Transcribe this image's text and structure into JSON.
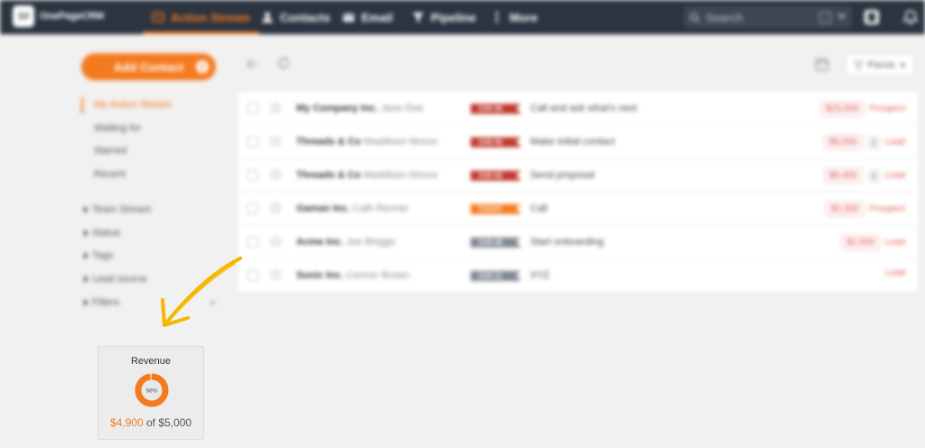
{
  "nav": {
    "logo_text": "OnePageCRM",
    "logo_mark": "1#",
    "items": [
      {
        "label": "Action Stream",
        "icon": "action-stream-icon",
        "active": true
      },
      {
        "label": "Contacts",
        "icon": "contacts-icon",
        "active": false
      },
      {
        "label": "Email",
        "icon": "email-icon",
        "active": false
      },
      {
        "label": "Pipeline",
        "icon": "pipeline-icon",
        "active": false
      },
      {
        "label": "More",
        "icon": "more-icon",
        "active": false
      }
    ],
    "search_placeholder": "Search",
    "search_kbd": "/"
  },
  "sidebar": {
    "add_contact_label": "Add Contact",
    "add_plus": "+",
    "links": [
      "My Action Stream",
      "Waiting for",
      "Starred",
      "Recent"
    ],
    "groups": [
      "Team Stream",
      "Status",
      "Tags",
      "Lead source",
      "Filters"
    ],
    "filters_plus": "+"
  },
  "toolbar": {
    "focus_label": "Focus"
  },
  "actions": [
    {
      "company": "My Company Inc.",
      "person": "Jane Doe",
      "date": "JUN 06",
      "tag_color": "#c0392b",
      "text": "Call and ask what's next",
      "amount": "$25,000",
      "count": "",
      "status": "Prospect"
    },
    {
      "company": "Threads & Co",
      "person": "Maddison Moore",
      "date": "JUN 06",
      "tag_color": "#c0392b",
      "text": "Make initial contact",
      "amount": "$6,000",
      "count": "2",
      "status": "Lead"
    },
    {
      "company": "Threads & Co",
      "person": "Maddison Moore",
      "date": "JUN 06",
      "tag_color": "#c0392b",
      "text": "Send proposal",
      "amount": "$6,400",
      "count": "2",
      "status": "Lead"
    },
    {
      "company": "Gaman Inc.",
      "person": "Cath Renner",
      "date": "TODAY",
      "tag_color": "#f47a20",
      "text": "Call",
      "amount": "$2,300",
      "count": "",
      "status": "Prospect"
    },
    {
      "company": "Acme Inc.",
      "person": "Joe Bloggs",
      "date": "JUN 08",
      "tag_color": "#7f8791",
      "text": "Start onboarding",
      "amount": "$1,500",
      "count": "",
      "status": "Lead"
    },
    {
      "company": "Sonic Inc.",
      "person": "Connor Brown",
      "date": "JUN 11",
      "tag_color": "#7f8791",
      "text": "XYZ",
      "amount": "",
      "count": "",
      "status": "Lead"
    }
  ],
  "revenue": {
    "title": "Revenue",
    "percent_label": "98%",
    "percent": 98,
    "current": "$4,900",
    "of_word": "of",
    "target": "$5,000"
  },
  "colors": {
    "accent": "#f47a20",
    "nav_bg": "#2b3440",
    "annotation_arrow": "#f5b800"
  }
}
